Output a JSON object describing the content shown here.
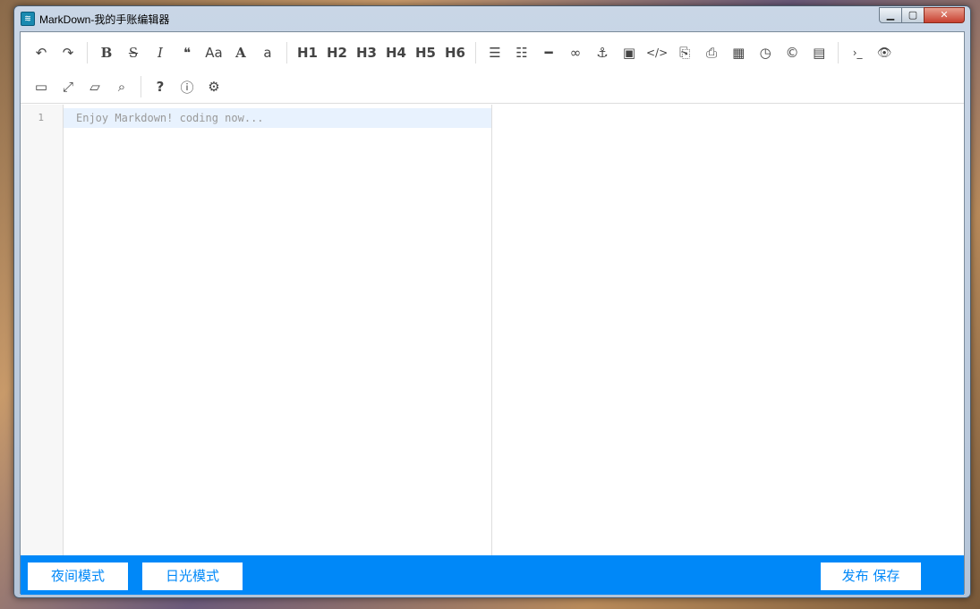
{
  "window": {
    "title": "MarkDown-我的手账编辑器",
    "app_icon": "editor-logo-icon"
  },
  "toolbar": {
    "undo": "↶",
    "redo": "↷",
    "bold": "B",
    "strike": "S",
    "italic": "I",
    "quote": "❝",
    "uppercase": "Aa",
    "ucfirst": "A",
    "lowercase": "a",
    "h1": "H1",
    "h2": "H2",
    "h3": "H3",
    "h4": "H4",
    "h5": "H5",
    "h6": "H6",
    "list_ul": "☰",
    "list_ol": "☷",
    "hr": "━",
    "link": "∞",
    "anchor": "⚓",
    "image": "▣",
    "code": "</>",
    "code_block": "⎘",
    "code_file": "⎙",
    "table": "▦",
    "datetime": "◷",
    "emoji": "©",
    "html_entities": "▤",
    "goto_line": "›_",
    "watch": "👁",
    "preview": "▭",
    "fullscreen": "⤢",
    "clear": "▱",
    "search": "⌕",
    "help": "?",
    "info": "ⓘ",
    "settings": "⚙"
  },
  "editor": {
    "line_number": "1",
    "placeholder": "Enjoy Markdown! coding now..."
  },
  "bottom": {
    "night_mode": "夜间模式",
    "day_mode": "日光模式",
    "publish_save": "发布 保存"
  },
  "colors": {
    "accent": "#0088f8",
    "active_line": "#e8f2fe"
  }
}
